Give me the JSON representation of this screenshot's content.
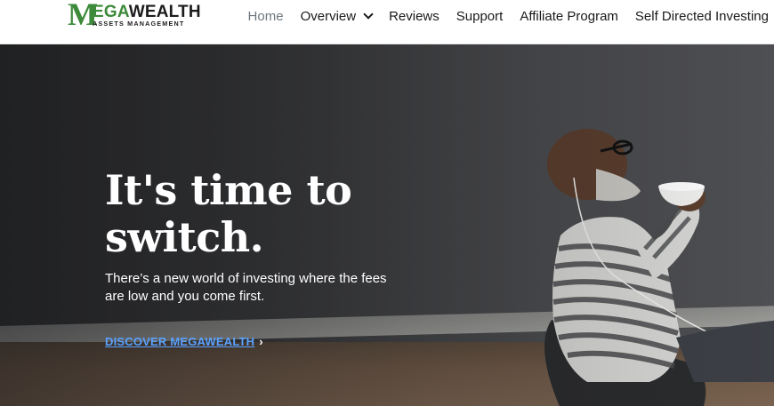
{
  "logo": {
    "initial": "M",
    "word_green": "EGA",
    "word_dark": "WEALTH",
    "tagline": "ASSETS MANAGEMENT"
  },
  "nav": {
    "items": [
      {
        "label": "Home",
        "active": true
      },
      {
        "label": "Overview",
        "has_dropdown": true
      },
      {
        "label": "Reviews"
      },
      {
        "label": "Support"
      },
      {
        "label": "Affiliate Program"
      },
      {
        "label": "Self Directed Investing"
      }
    ]
  },
  "hero": {
    "headline_line1": "It's time to",
    "headline_line2": "switch.",
    "subtext": "There’s a new world of investing where the fees are low and you come first.",
    "cta_label": "DISCOVER MEGAWEALTH",
    "cta_arrow": "›"
  },
  "colors": {
    "brand_green": "#3d8a3a",
    "link_blue": "#5aa2ff",
    "nav_active": "#6f7780"
  }
}
